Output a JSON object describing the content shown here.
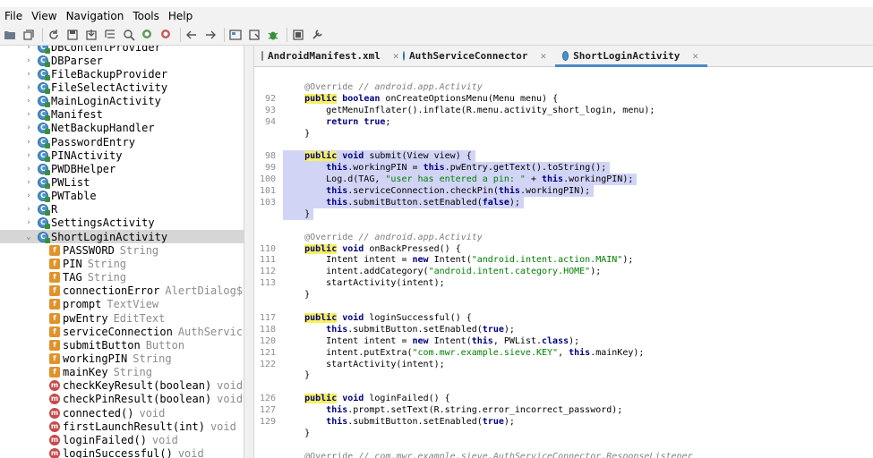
{
  "menubar": {
    "items": [
      "File",
      "View",
      "Navigation",
      "Tools",
      "Help"
    ]
  },
  "toolbar": {
    "icons": [
      "open-folder-icon",
      "save-all-icon",
      "refresh-icon",
      "save-icon",
      "export-icon",
      "tree-icon",
      "search-icon",
      "find-class-icon",
      "find-usage-icon",
      "back-icon",
      "forward-icon",
      "decompile-icon",
      "bookmark-icon",
      "bug-icon",
      "log-icon",
      "preferences-icon"
    ]
  },
  "tree": {
    "items": [
      {
        "label": "DBContentProvider",
        "kind": "class",
        "type": ""
      },
      {
        "label": "DBParser",
        "kind": "class",
        "type": ""
      },
      {
        "label": "FileBackupProvider",
        "kind": "class",
        "type": ""
      },
      {
        "label": "FileSelectActivity",
        "kind": "class",
        "type": ""
      },
      {
        "label": "MainLoginActivity",
        "kind": "class",
        "type": ""
      },
      {
        "label": "Manifest",
        "kind": "class",
        "type": ""
      },
      {
        "label": "NetBackupHandler",
        "kind": "class",
        "type": ""
      },
      {
        "label": "PasswordEntry",
        "kind": "class",
        "type": ""
      },
      {
        "label": "PINActivity",
        "kind": "class",
        "type": ""
      },
      {
        "label": "PWDBHelper",
        "kind": "class",
        "type": ""
      },
      {
        "label": "PWList",
        "kind": "class",
        "type": ""
      },
      {
        "label": "PWTable",
        "kind": "class",
        "type": ""
      },
      {
        "label": "R",
        "kind": "class",
        "type": ""
      },
      {
        "label": "SettingsActivity",
        "kind": "class",
        "type": ""
      },
      {
        "label": "ShortLoginActivity",
        "kind": "class-open",
        "type": ""
      },
      {
        "label": "PASSWORD",
        "kind": "field",
        "type": "String"
      },
      {
        "label": "PIN",
        "kind": "field",
        "type": "String"
      },
      {
        "label": "TAG",
        "kind": "field",
        "type": "String"
      },
      {
        "label": "connectionError",
        "kind": "field",
        "type": "AlertDialog$Bu"
      },
      {
        "label": "prompt",
        "kind": "field",
        "type": "TextView"
      },
      {
        "label": "pwEntry",
        "kind": "field",
        "type": "EditText"
      },
      {
        "label": "serviceConnection",
        "kind": "field",
        "type": "AuthServiceC"
      },
      {
        "label": "submitButton",
        "kind": "field",
        "type": "Button"
      },
      {
        "label": "workingPIN",
        "kind": "field",
        "type": "String"
      },
      {
        "label": "mainKey",
        "kind": "field",
        "type": "String"
      },
      {
        "label": "checkKeyResult(boolean)",
        "kind": "method",
        "type": "void"
      },
      {
        "label": "checkPinResult(boolean)",
        "kind": "method",
        "type": "void"
      },
      {
        "label": "connected()",
        "kind": "method",
        "type": "void"
      },
      {
        "label": "firstLaunchResult(int)",
        "kind": "method",
        "type": "void"
      },
      {
        "label": "loginFailed()",
        "kind": "method",
        "type": "void"
      },
      {
        "label": "loginSuccessful()",
        "kind": "method",
        "type": "void"
      }
    ]
  },
  "tabs": [
    {
      "label": "AndroidManifest.xml",
      "icon": "xml-file-icon",
      "active": false
    },
    {
      "label": "AuthServiceConnector",
      "icon": "class-icon",
      "active": false
    },
    {
      "label": "ShortLoginActivity",
      "icon": "class-icon",
      "active": true
    }
  ],
  "code": {
    "lines": [
      {
        "n": "",
        "html": ""
      },
      {
        "n": "",
        "html": "    <span class=\"ann\">@Override</span> <span class=\"cmt\">// android.app.Activity</span>"
      },
      {
        "n": "92",
        "html": "    <span class=\"kwhl\">public</span> <span class=\"kw\">boolean</span> onCreateOptionsMenu(Menu menu) {"
      },
      {
        "n": "93",
        "html": "        getMenuInflater().inflate(R.menu.activity_short_login, menu);"
      },
      {
        "n": "94",
        "html": "        <span class=\"kw\">return</span> <span class=\"kw\">true</span>;"
      },
      {
        "n": "",
        "html": "    }"
      },
      {
        "n": "",
        "html": ""
      },
      {
        "n": "98",
        "html": "    <span class=\"kwhl\">public</span> <span class=\"kw\">void</span> submit(View view) {",
        "sel": true
      },
      {
        "n": "99",
        "html": "        <span class=\"kw\">this</span>.workingPIN = <span class=\"kw\">this</span>.pwEntry.getText().toString();",
        "sel": true
      },
      {
        "n": "100",
        "html": "        Log.d(TAG, <span class=\"str\">\"user has entered a pin: \"</span> + <span class=\"kw\">this</span>.workingPIN);",
        "sel": true
      },
      {
        "n": "101",
        "html": "        <span class=\"kw\">this</span>.serviceConnection.checkPin(<span class=\"kw\">this</span>.workingPIN);",
        "sel": true
      },
      {
        "n": "103",
        "html": "        <span class=\"kw\">this</span>.submitButton.setEnabled(<span class=\"kw\">false</span>);",
        "sel": true
      },
      {
        "n": "",
        "html": "    }",
        "sel": true
      },
      {
        "n": "",
        "html": ""
      },
      {
        "n": "",
        "html": "    <span class=\"ann\">@Override</span> <span class=\"cmt\">// android.app.Activity</span>"
      },
      {
        "n": "110",
        "html": "    <span class=\"kwhl\">public</span> <span class=\"kw\">void</span> onBackPressed() {"
      },
      {
        "n": "111",
        "html": "        Intent intent = <span class=\"kw\">new</span> Intent(<span class=\"str\">\"android.intent.action.MAIN\"</span>);"
      },
      {
        "n": "112",
        "html": "        intent.addCategory(<span class=\"str\">\"android.intent.category.HOME\"</span>);"
      },
      {
        "n": "113",
        "html": "        startActivity(intent);"
      },
      {
        "n": "",
        "html": "    }"
      },
      {
        "n": "",
        "html": ""
      },
      {
        "n": "117",
        "html": "    <span class=\"kwhl\">public</span> <span class=\"kw\">void</span> loginSuccessful() {"
      },
      {
        "n": "118",
        "html": "        <span class=\"kw\">this</span>.submitButton.setEnabled(<span class=\"kw\">true</span>);"
      },
      {
        "n": "120",
        "html": "        Intent intent = <span class=\"kw\">new</span> Intent(<span class=\"kw\">this</span>, PWList.<span class=\"kw\">class</span>);"
      },
      {
        "n": "121",
        "html": "        intent.putExtra(<span class=\"str\">\"com.mwr.example.sieve.KEY\"</span>, <span class=\"kw\">this</span>.mainKey);"
      },
      {
        "n": "122",
        "html": "        startActivity(intent);"
      },
      {
        "n": "",
        "html": "    }"
      },
      {
        "n": "",
        "html": ""
      },
      {
        "n": "126",
        "html": "    <span class=\"kwhl\">public</span> <span class=\"kw\">void</span> loginFailed() {"
      },
      {
        "n": "127",
        "html": "        <span class=\"kw\">this</span>.prompt.setText(R.string.error_incorrect_password);"
      },
      {
        "n": "129",
        "html": "        <span class=\"kw\">this</span>.submitButton.setEnabled(<span class=\"kw\">true</span>);"
      },
      {
        "n": "",
        "html": "    }"
      },
      {
        "n": "",
        "html": ""
      },
      {
        "n": "",
        "html": "    <span class=\"ann\">@Override</span> <span class=\"cmt\">// com.mwr.example.sieve.AuthServiceConnector.ResponseListener</span>"
      }
    ]
  }
}
